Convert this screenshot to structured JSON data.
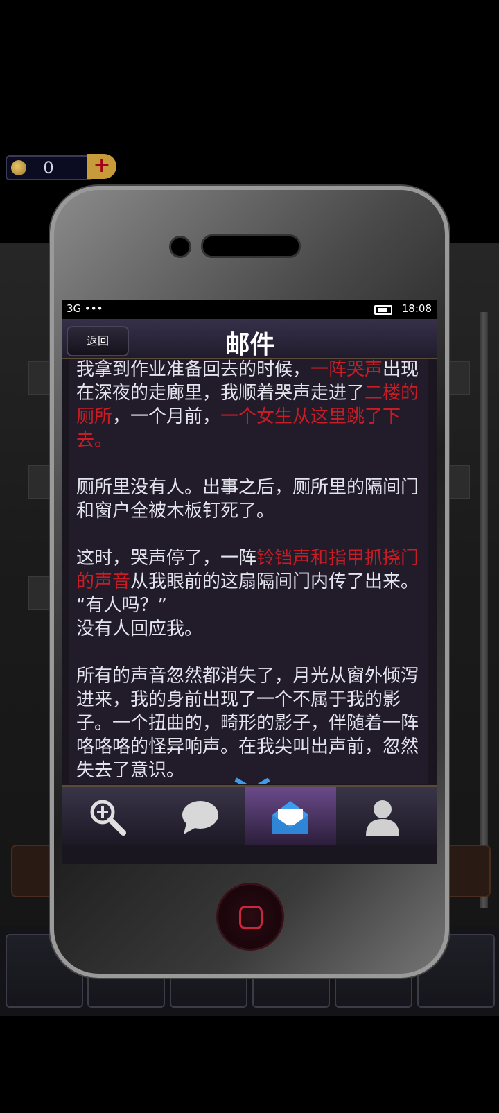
{
  "coins": {
    "count": "0"
  },
  "status_bar": {
    "carrier": "3G •••",
    "time": "18:08"
  },
  "nav": {
    "back_label": "返回",
    "title": "邮件"
  },
  "mail": {
    "paragraphs": [
      [
        {
          "text": "我拿到作业准备回去的时候，",
          "red": false
        },
        {
          "text": "一阵哭声",
          "red": true
        },
        {
          "text": "出现在深夜的走廊里，我顺着哭声走进了",
          "red": false
        },
        {
          "text": "二楼的厕所",
          "red": true
        },
        {
          "text": "，一个月前，",
          "red": false
        },
        {
          "text": "一个女生从这里跳了下去。",
          "red": true
        }
      ],
      [
        {
          "text": "厕所里没有人。出事之后，厕所里的隔间门和窗户全被木板钉死了。",
          "red": false
        }
      ],
      [
        {
          "text": "这时，哭声停了，一阵",
          "red": false
        },
        {
          "text": "铃铛声和指甲抓挠门的声音",
          "red": true
        },
        {
          "text": "从我眼前的这扇隔间门内传了出来。",
          "red": false
        },
        {
          "text": "\n“有人吗？”\n没有人回应我。",
          "red": false
        }
      ],
      [
        {
          "text": "所有的声音忽然都消失了，月光从窗外倾泻进来，我的身前出现了一个不属于我的影子。一个扭曲的，畸形的影子，伴随着一阵咯咯咯的怪异响声。在我尖叫出声前，忽然失去了意识。",
          "red": false
        }
      ]
    ]
  },
  "tabs": [
    {
      "name": "search",
      "icon": "magnifier-plus-icon",
      "active": false
    },
    {
      "name": "chat",
      "icon": "speech-bubble-icon",
      "active": false
    },
    {
      "name": "mail",
      "icon": "envelope-icon",
      "active": true
    },
    {
      "name": "profile",
      "icon": "person-icon",
      "active": false
    }
  ],
  "colors": {
    "highlight_red": "#c91c25",
    "accent_blue": "#3d9cf0"
  }
}
